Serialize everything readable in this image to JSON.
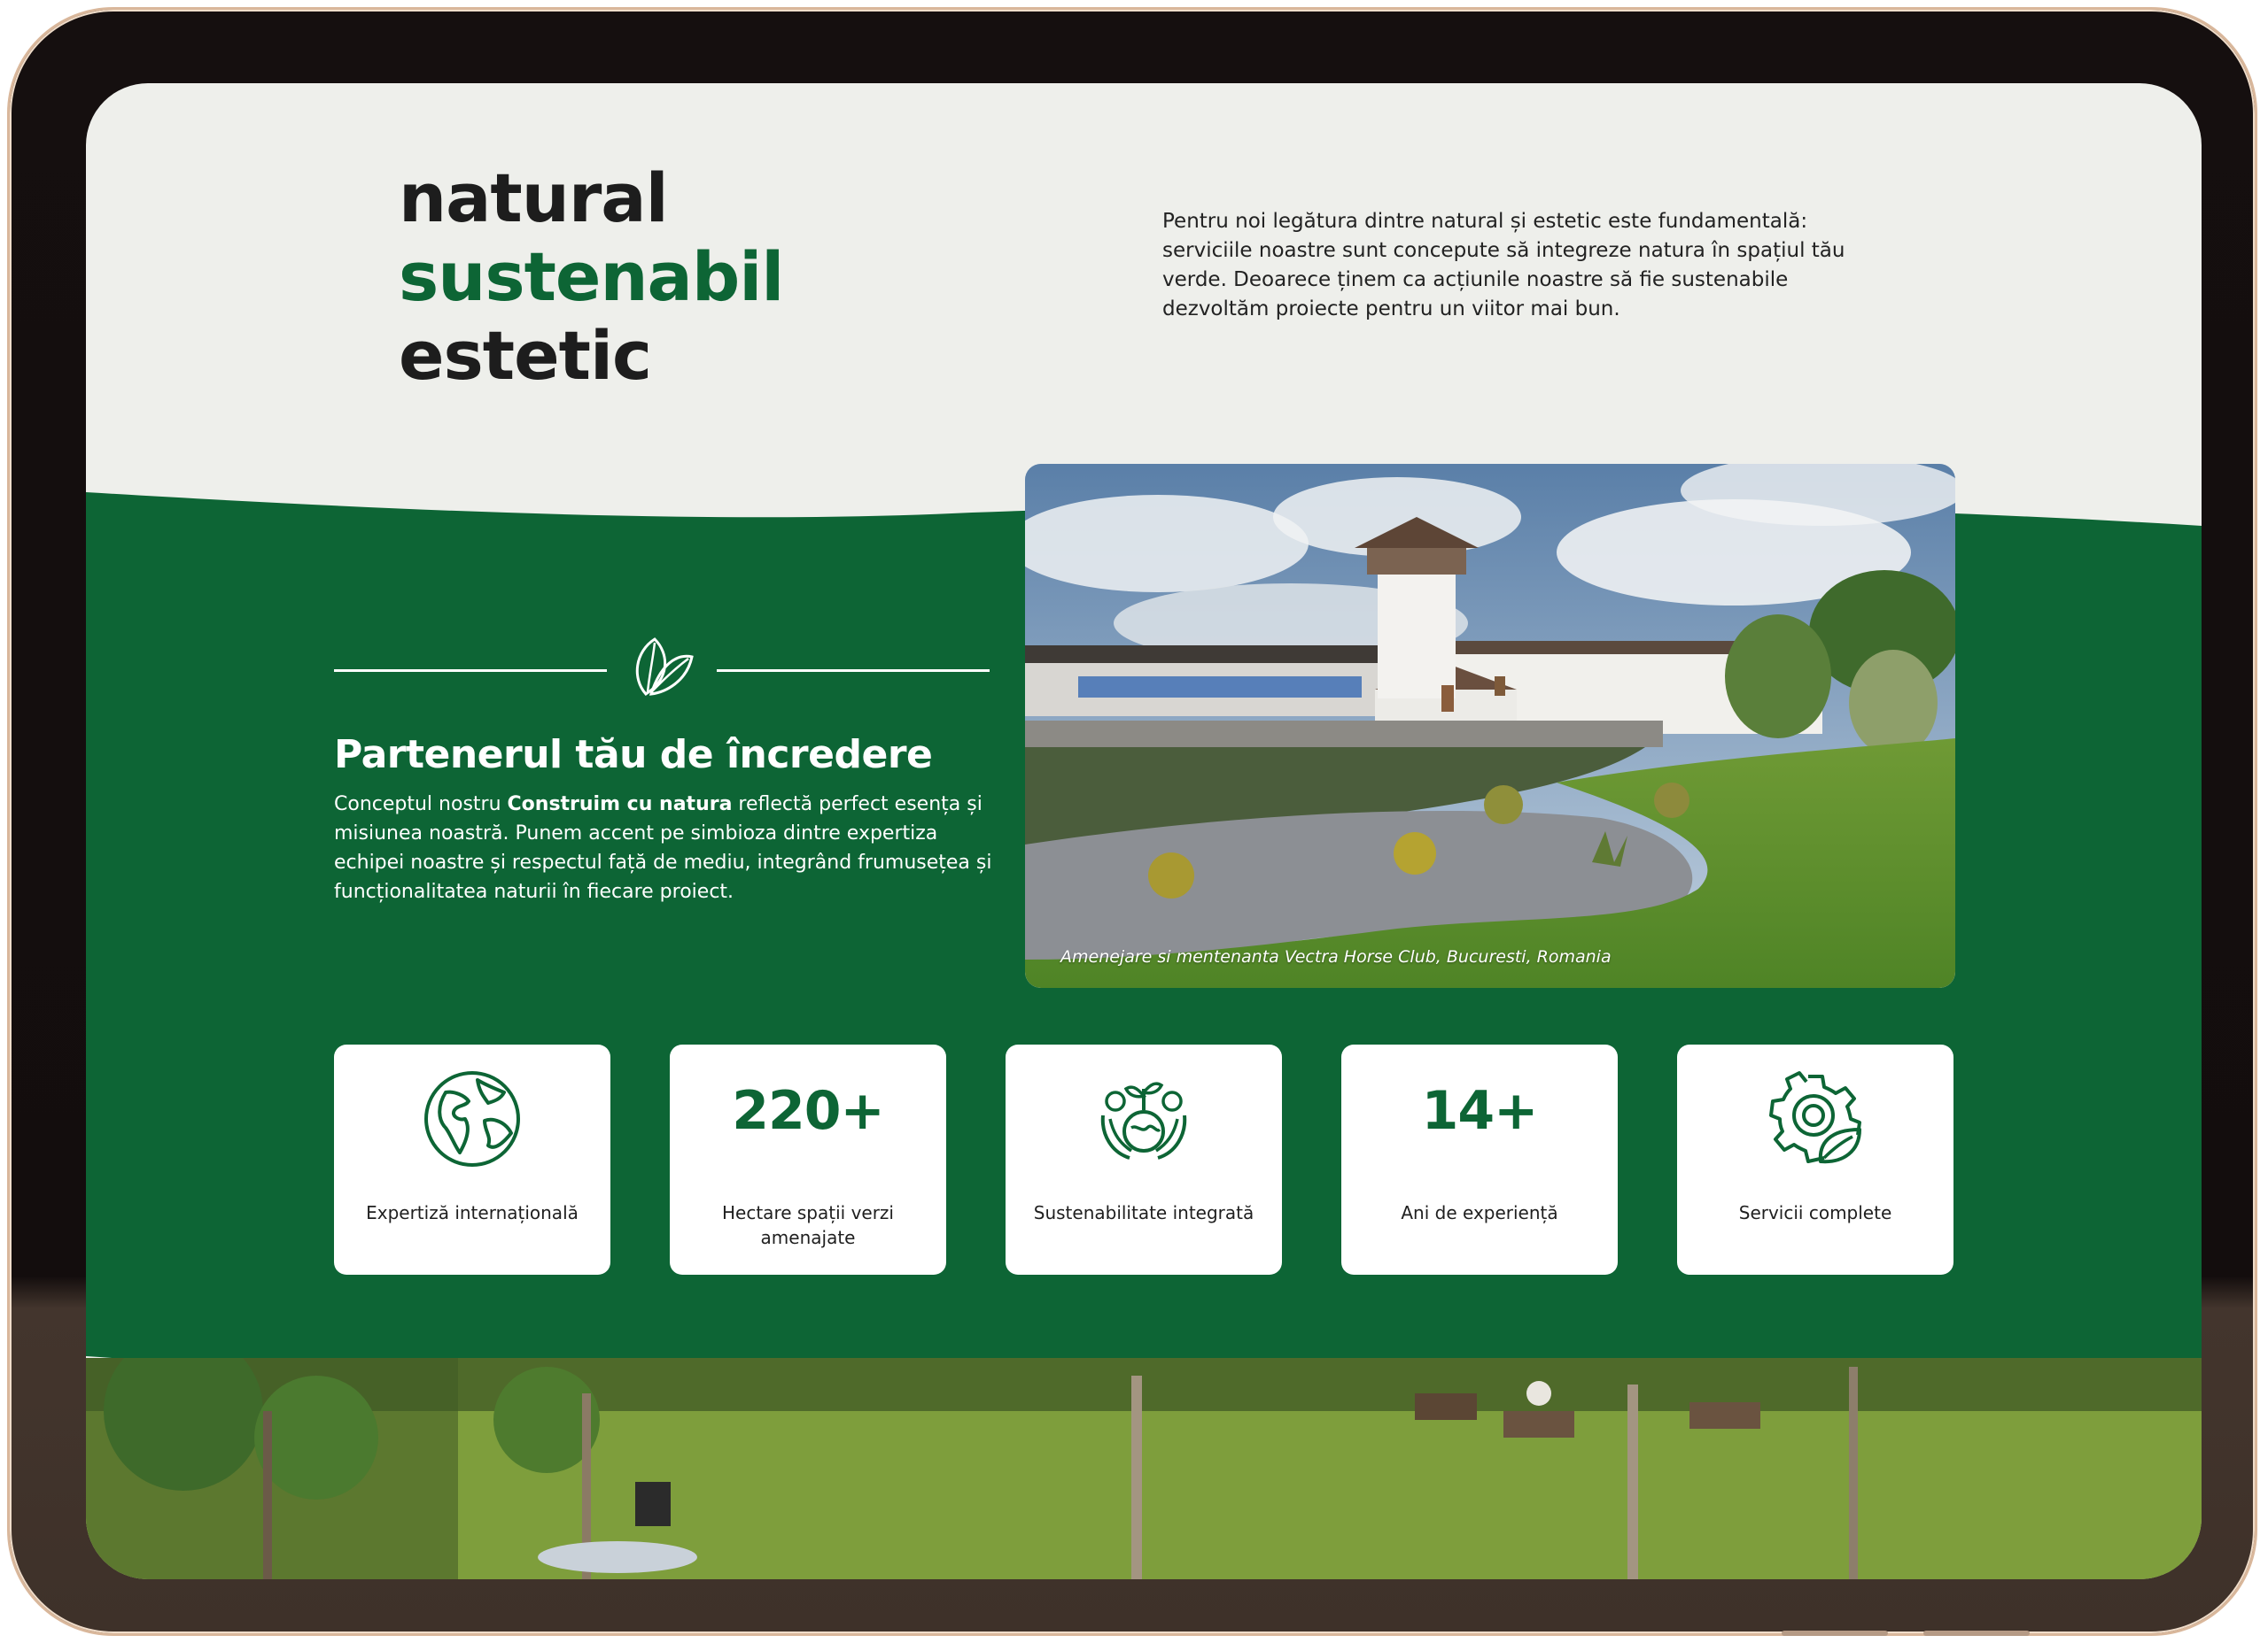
{
  "hero": {
    "words": [
      "natural",
      "sustenabil",
      "estetic"
    ],
    "text": "Pentru noi legătura dintre natural și estetic este fundamentală: serviciile noastre sunt concepute să integreze natura în spațiul tău verde. Deoarece ținem ca acțiunile noastre să fie sustenabile dezvoltăm proiecte pentru un viitor mai bun."
  },
  "partner": {
    "title": "Partenerul tău de încredere",
    "text_before": "Conceptul nostru ",
    "text_bold": "Construim cu natura",
    "text_after": " reflectă perfect esența și misiunea noastră. Punem accent pe simbioza dintre expertiza echipei noastre și respectul față de mediu, integrând frumusețea și funcționalitatea naturii în fiecare proiect."
  },
  "photo": {
    "caption": "Amenejare si mentenanta Vectra Horse Club, Bucuresti, Romania"
  },
  "stats": [
    {
      "icon": "globe-icon",
      "number": "",
      "label": "Expertiză internațională"
    },
    {
      "icon": "",
      "number": "220+",
      "label": "Hectare spații verzi amenajate"
    },
    {
      "icon": "sustainability-hands-icon",
      "number": "",
      "label": "Sustenabilitate integrată"
    },
    {
      "icon": "",
      "number": "14+",
      "label": "Ani de experiență"
    },
    {
      "icon": "gear-leaf-icon",
      "number": "",
      "label": "Servicii complete"
    }
  ],
  "colors": {
    "brand_green": "#0d6535",
    "hero_background": "#eeefeb",
    "text_dark": "#1d1d1d"
  }
}
